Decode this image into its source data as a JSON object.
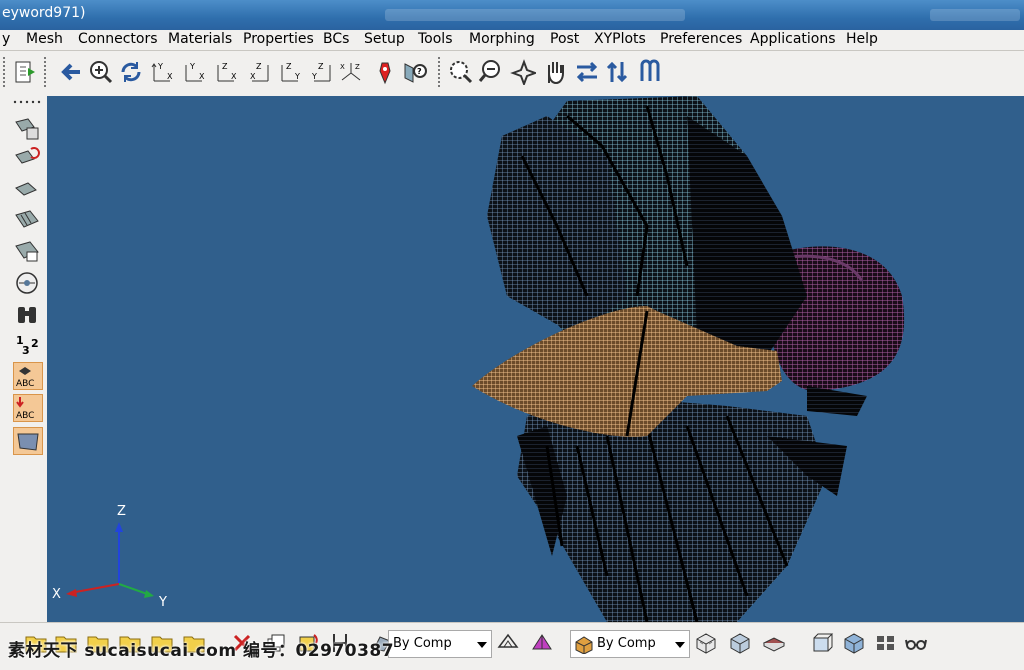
{
  "window": {
    "title": "eyword971)"
  },
  "menu": [
    "y",
    "Mesh",
    "Connectors",
    "Materials",
    "Properties",
    "BCs",
    "Setup",
    "Tools",
    "Morphing",
    "Post",
    "XYPlots",
    "Preferences",
    "Applications",
    "Help"
  ],
  "toolbar_icons": [
    "export-icon",
    "arrow-left-icon",
    "zoom-fit-icon",
    "rotate-icon",
    "view-xy-icon",
    "view-xz-icon",
    "view-zx-icon",
    "view-yz-icon",
    "view-zy-icon",
    "view-iso-icon",
    "view-iso2-icon",
    "color-picker-icon",
    "find-icon",
    "zoom-window-icon",
    "zoom-out-icon",
    "rotate-center-icon",
    "pan-hand-icon",
    "swap-horizontal-icon",
    "swap-vertical-icon",
    "flip-icon"
  ],
  "left_toolbar_icons": [
    "dots-handle-icon",
    "mask-elements-icon",
    "unmask-elements-icon",
    "reverse-mask-icon",
    "show-elements-icon",
    "find-attached-icon",
    "shaded-icon",
    "binoculars-icon",
    "numbering-icon",
    "label-elements-icon",
    "label-nodes-icon",
    "component-color-icon"
  ],
  "axes": {
    "z": "Z",
    "x": "X",
    "y": "Y"
  },
  "bottom": {
    "color_mode_1": "By Comp",
    "color_mode_2": "By Comp",
    "icons": [
      "folder-open-icon",
      "folder-icon",
      "folder2-icon",
      "folder3-icon",
      "folder4-icon",
      "folder5-icon",
      "delete-x-icon",
      "copy-icon",
      "refresh-icon",
      "split-icon",
      "mesh-display-icon",
      "wireframe-icon",
      "shaded-elements-icon",
      "color-by-comp-icon",
      "feature-lines-icon",
      "shrink-icon",
      "box-icon",
      "cube-icon",
      "grid-icon",
      "glasses-icon"
    ]
  },
  "watermark": "素材天下 sucaisucai.com  编号：02970387",
  "colors": {
    "viewport_bg": "#305f8c",
    "toolbar_bg": "#f1f0ee",
    "highlight": "#f4c896"
  }
}
